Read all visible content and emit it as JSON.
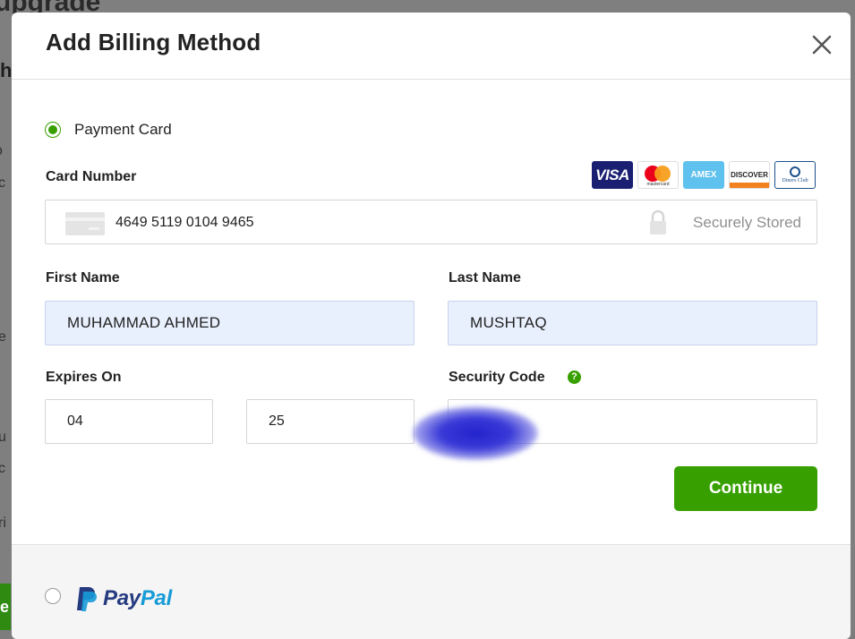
{
  "background": {
    "title_fragment": "upgrade",
    "heading_fragment": "h",
    "fragments": [
      "o",
      "c",
      "e",
      "u",
      "c",
      "ri"
    ],
    "green_button_fragment": "e"
  },
  "modal": {
    "title": "Add Billing Method",
    "payment_card": {
      "option_label": "Payment Card",
      "card_number_label": "Card Number",
      "card_number_value": "4649 5119 0104 9465",
      "secure_text": "Securely Stored",
      "card_brands": [
        "VISA",
        "mastercard",
        "AMEX",
        "DISCOVER",
        "Diners Club"
      ],
      "first_name_label": "First Name",
      "first_name_value": "MUHAMMAD AHMED",
      "last_name_label": "Last Name",
      "last_name_value": "MUSHTAQ",
      "expires_label": "Expires On",
      "expires_month": "04",
      "expires_year": "25",
      "security_code_label": "Security Code",
      "security_help": "?",
      "continue_label": "Continue"
    },
    "paypal": {
      "pay": "Pay",
      "pal": "Pal"
    }
  },
  "colors": {
    "accent_green": "#37a000",
    "autofill_blue": "#e8f0fe"
  }
}
